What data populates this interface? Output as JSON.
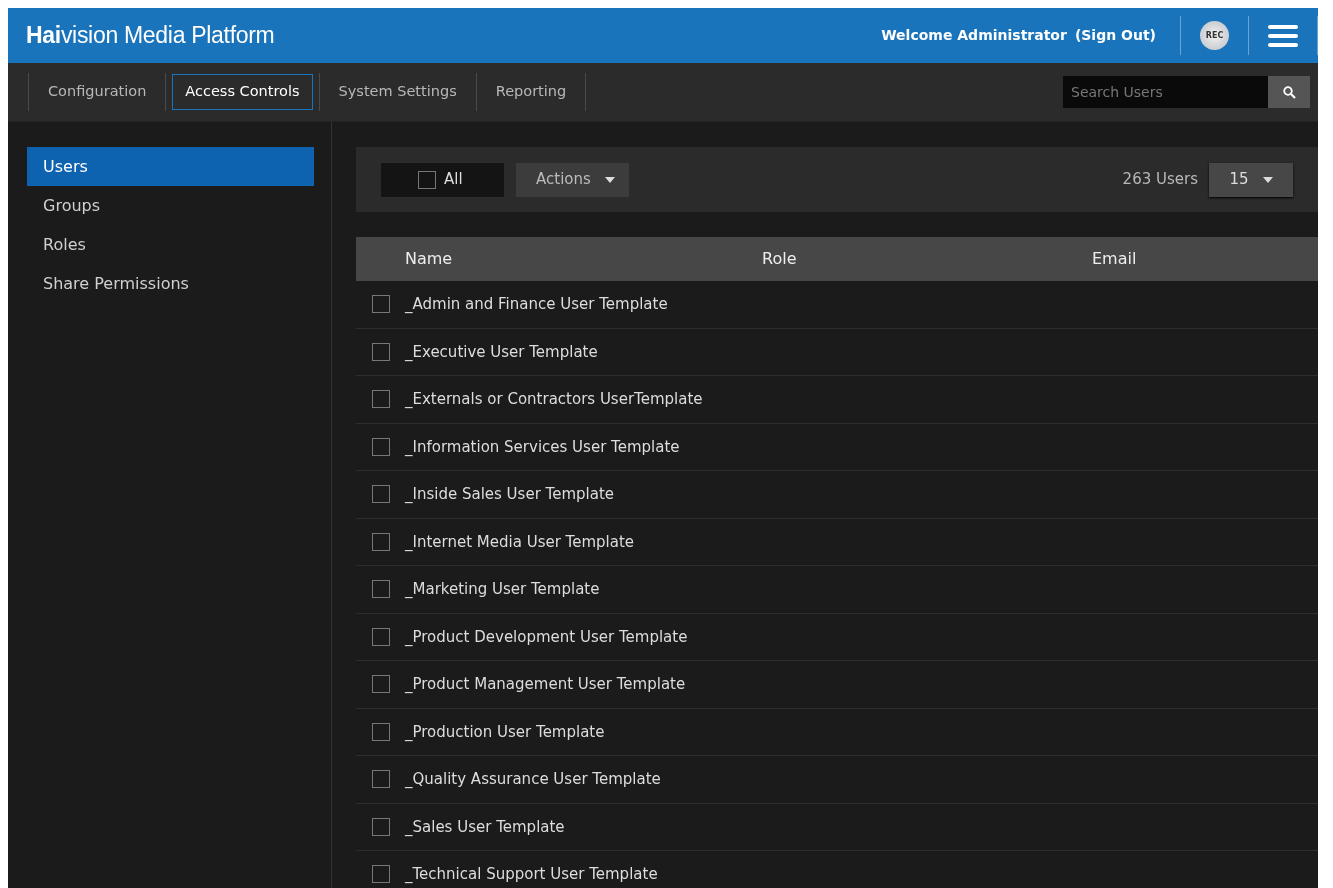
{
  "header": {
    "brand_bold": "Hai",
    "brand_rest": "vision Media Platform",
    "welcome": "Welcome Administrator",
    "sign_out": "(Sign Out)",
    "rec": "REC"
  },
  "nav": [
    {
      "label": "Configuration",
      "selected": false
    },
    {
      "label": "Access Controls",
      "selected": true
    },
    {
      "label": "System Settings",
      "selected": false
    },
    {
      "label": "Reporting",
      "selected": false
    }
  ],
  "search": {
    "placeholder": "Search Users"
  },
  "sidebar": {
    "items": [
      {
        "label": "Users",
        "selected": true
      },
      {
        "label": "Groups",
        "selected": false
      },
      {
        "label": "Roles",
        "selected": false
      },
      {
        "label": "Share Permissions",
        "selected": false
      }
    ]
  },
  "toolbar": {
    "select_all": {
      "label": "All",
      "checked": false
    },
    "actions": "Actions",
    "count": "263 Users",
    "page_size": "15"
  },
  "table": {
    "columns": [
      "Name",
      "Role",
      "Email"
    ],
    "rows": [
      {
        "name": "_Admin and Finance User Template",
        "checked": false
      },
      {
        "name": "_Executive User Template",
        "checked": false
      },
      {
        "name": "_Externals or Contractors UserTemplate",
        "checked": false
      },
      {
        "name": "_Information Services User Template",
        "checked": false
      },
      {
        "name": "_Inside Sales User Template",
        "checked": false
      },
      {
        "name": "_Internet Media User Template",
        "checked": false
      },
      {
        "name": "_Marketing User Template",
        "checked": false
      },
      {
        "name": "_Product Development User Template",
        "checked": false
      },
      {
        "name": "_Product Management User Template",
        "checked": false
      },
      {
        "name": "_Production User Template",
        "checked": false
      },
      {
        "name": "_Quality Assurance User Template",
        "checked": false
      },
      {
        "name": "_Sales User Template",
        "checked": false
      },
      {
        "name": "_Technical Support User Template",
        "checked": false
      }
    ]
  }
}
